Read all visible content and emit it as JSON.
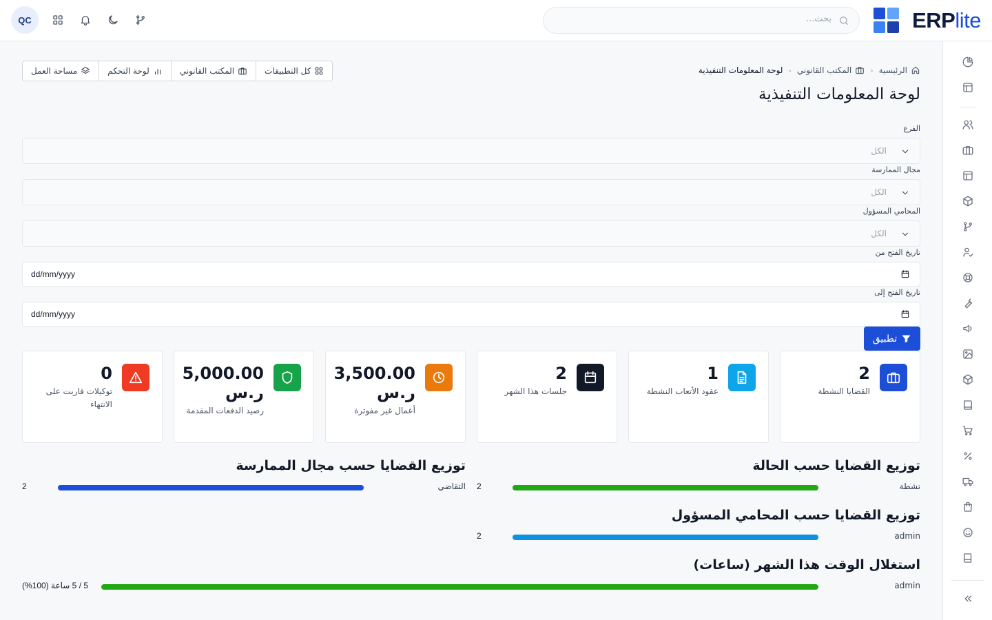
{
  "brand": {
    "name_bold": "ERP",
    "name_light": "lite",
    "colors": [
      "#1d4ed8",
      "#3b82f6",
      "#60a5fa",
      "#1e3a8a"
    ]
  },
  "header": {
    "search_placeholder": "بحث...",
    "user_initials": "QC",
    "icons": [
      "git-branch-icon",
      "moon-icon",
      "bell-icon",
      "apps-grid-icon"
    ]
  },
  "breadcrumb": {
    "home": "الرئيسية",
    "section": "المكتب القانوني",
    "current": "لوحة المعلومات التنفيذية"
  },
  "quick_nav": {
    "all_apps": "كل التطبيقات",
    "legal_office": "المكتب القانوني",
    "dashboard": "لوحة التحكم",
    "workspace": "مساحة العمل"
  },
  "page_title": "لوحة المعلومات التنفيذية",
  "filters": {
    "branch": {
      "label": "الفرع",
      "value": "الكل"
    },
    "practice_area": {
      "label": "مجال الممارسة",
      "value": "الكل"
    },
    "lawyer": {
      "label": "المحامي المسؤول",
      "value": "الكل"
    },
    "opened_from": {
      "label": "تاريخ الفتح من",
      "value": "dd/mm/yyyy"
    },
    "opened_to": {
      "label": "تاريخ الفتح إلى",
      "value": "dd/mm/yyyy"
    },
    "apply_label": "تطبيق"
  },
  "stats": [
    {
      "value": "2",
      "label": "القضايا النشطة",
      "color": "#1d4ed8",
      "icon": "briefcase-icon"
    },
    {
      "value": "1",
      "label": "عقود الأتعاب النشطة",
      "color": "#0ea5e9",
      "icon": "document-icon"
    },
    {
      "value": "2",
      "label": "جلسات هذا الشهر",
      "color": "#111827",
      "icon": "calendar-icon"
    },
    {
      "value": "3,500.00 ر.س",
      "label": "أعمال غير مفوترة",
      "color": "#ea7a0c",
      "icon": "clock-icon"
    },
    {
      "value": "5,000.00 ر.س",
      "label": "رصيد الدفعات المقدمة",
      "color": "#16a34a",
      "icon": "shield-icon"
    },
    {
      "value": "0",
      "label": "توكيلات قاربت على الانتهاء",
      "color": "#ef3b24",
      "icon": "warning-icon"
    }
  ],
  "distributions": {
    "by_status": {
      "title": "توزيع القضايا حسب الحالة",
      "rows": [
        {
          "label": "نشطة",
          "value": 2,
          "max": 2,
          "color": "#22a815"
        }
      ]
    },
    "by_practice": {
      "title": "توزيع القضايا حسب مجال الممارسة",
      "rows": [
        {
          "label": "التقاضي",
          "value": 2,
          "max": 2,
          "color": "#1d4ed8"
        }
      ]
    },
    "by_lawyer": {
      "title": "توزيع القضايا حسب المحامي المسؤول",
      "rows": [
        {
          "label": "admin",
          "value": 2,
          "max": 2,
          "color": "#0e90e0"
        }
      ]
    },
    "utilization": {
      "title": "استغلال الوقت هذا الشهر (ساعات)",
      "rows": [
        {
          "label": "admin",
          "value_text": "5 / 5 ساعة (100%)",
          "percent": 100,
          "color": "#22a815"
        }
      ]
    }
  },
  "sidebar_icons": [
    "analytics-icon",
    "layout-icon",
    "users-icon",
    "briefcase-icon",
    "table-icon",
    "box-icon",
    "git-branch-icon",
    "user-check-icon",
    "lifebuoy-icon",
    "wrench-icon",
    "megaphone-icon",
    "image-icon",
    "package-icon",
    "book-icon",
    "cart-icon",
    "percent-icon",
    "truck-icon",
    "shopping-bag-icon",
    "smile-icon",
    "notebook-icon",
    "collapse-icon"
  ]
}
